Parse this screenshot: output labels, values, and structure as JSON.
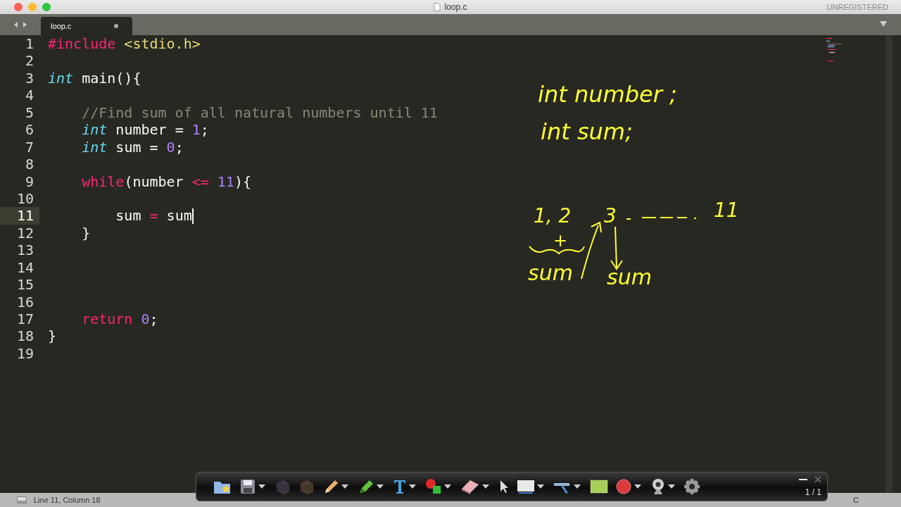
{
  "window": {
    "title": "loop.c",
    "registration": "UNREGISTERED"
  },
  "tabs": [
    {
      "label": "loop.c",
      "selected": true,
      "modified": true
    }
  ],
  "editor": {
    "lines": [
      {
        "number": "1",
        "current": false,
        "tokens": [
          {
            "kind": "keyword",
            "text": "#include"
          },
          {
            "kind": "string",
            "text": " <stdio.h>"
          }
        ]
      },
      {
        "number": "2",
        "current": false
      },
      {
        "number": "3",
        "current": false,
        "tokens": [
          {
            "kind": "type",
            "text": "int"
          },
          {
            "kind": "plain",
            "text": " main(){"
          }
        ]
      },
      {
        "number": "4",
        "current": false
      },
      {
        "number": "5",
        "current": false,
        "tokens": [
          {
            "kind": "comment",
            "text": "    //Find sum of all natural numbers until 11"
          }
        ]
      },
      {
        "number": "6",
        "current": false,
        "tokens": [
          {
            "kind": "type",
            "text": "    int"
          },
          {
            "kind": "plain",
            "text": " number = "
          },
          {
            "kind": "number",
            "text": "1"
          },
          {
            "kind": "plain",
            "text": ";"
          }
        ]
      },
      {
        "number": "7",
        "current": false,
        "tokens": [
          {
            "kind": "type",
            "text": "    int"
          },
          {
            "kind": "plain",
            "text": " sum = "
          },
          {
            "kind": "number",
            "text": "0"
          },
          {
            "kind": "plain",
            "text": ";"
          }
        ]
      },
      {
        "number": "8",
        "current": false
      },
      {
        "number": "9",
        "current": false,
        "tokens": [
          {
            "kind": "keyword",
            "text": "    while"
          },
          {
            "kind": "plain",
            "text": "(number "
          },
          {
            "kind": "keyword",
            "text": "<= "
          },
          {
            "kind": "number",
            "text": "11"
          },
          {
            "kind": "plain",
            "text": "){"
          }
        ]
      },
      {
        "number": "10",
        "current": false
      },
      {
        "number": "11",
        "current": true,
        "tokens": [
          {
            "kind": "plain",
            "text": "        sum "
          },
          {
            "kind": "keyword",
            "text": "="
          },
          {
            "kind": "plain",
            "text": " sum"
          }
        ]
      },
      {
        "number": "12",
        "current": false,
        "tokens": [
          {
            "kind": "plain",
            "text": "    }"
          }
        ]
      },
      {
        "number": "13",
        "current": false
      },
      {
        "number": "14",
        "current": false
      },
      {
        "number": "15",
        "current": false
      },
      {
        "number": "16",
        "current": false
      },
      {
        "number": "17",
        "current": false,
        "tokens": [
          {
            "kind": "keyword",
            "text": "    return "
          },
          {
            "kind": "number",
            "text": "0"
          },
          {
            "kind": "plain",
            "text": ";"
          }
        ]
      },
      {
        "number": "18",
        "current": false,
        "tokens": [
          {
            "kind": "plain",
            "text": "}"
          }
        ]
      },
      {
        "number": "19",
        "current": false
      }
    ]
  },
  "annotations": [
    {
      "text": "int number ;"
    },
    {
      "text": "int sum;"
    },
    {
      "text": "1, 2"
    },
    {
      "text": "3"
    },
    {
      "text": "11"
    },
    {
      "text": "+"
    },
    {
      "text": "sum"
    },
    {
      "text": "sum"
    }
  ],
  "annotation_toolbar": {
    "page": "1 / 1"
  },
  "status_bar": {
    "position": "Line 11, Column 18",
    "syntax": "C"
  }
}
